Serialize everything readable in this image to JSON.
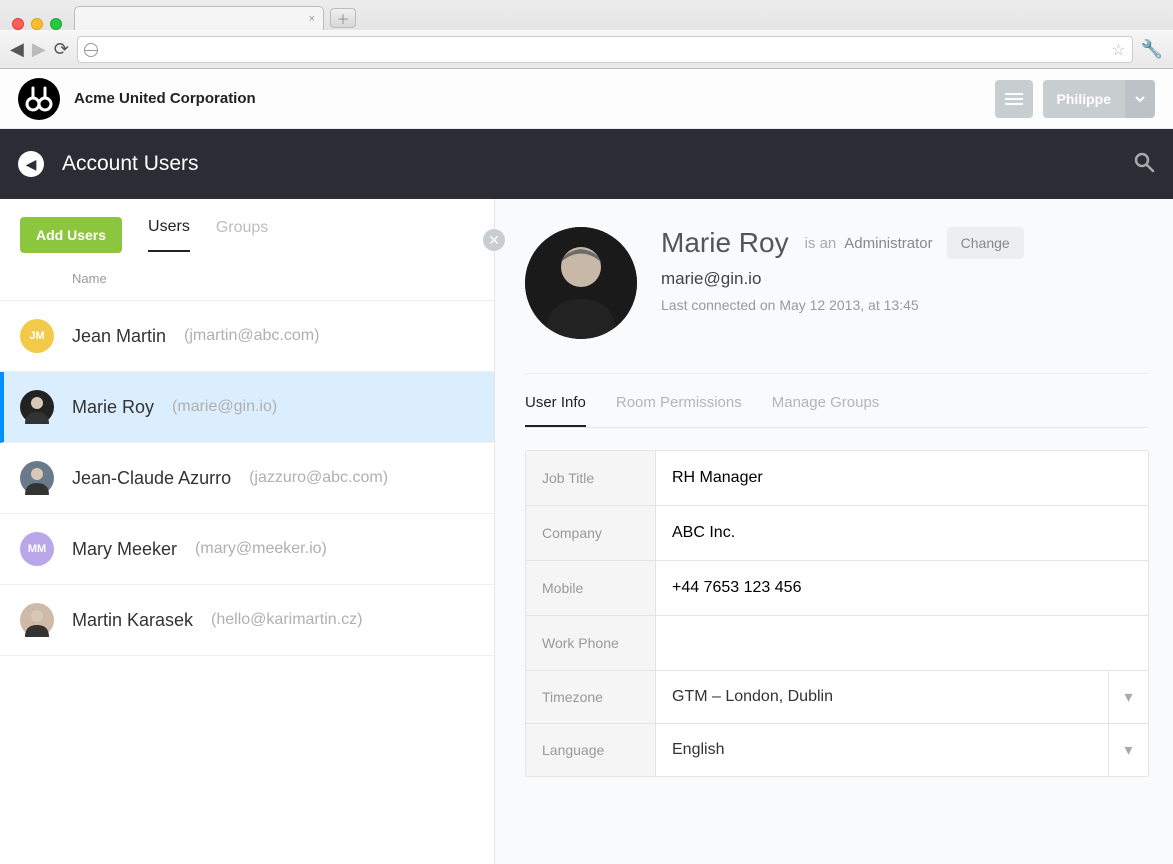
{
  "header": {
    "brand": "Acme United Corporation",
    "user": "Philippe"
  },
  "subheader": {
    "title": "Account Users"
  },
  "left": {
    "add_button": "Add Users",
    "tabs": {
      "users": "Users",
      "groups": "Groups"
    },
    "column_header": "Name",
    "users": [
      {
        "name": "Jean Martin",
        "email": "(jmartin@abc.com)",
        "initials": "JM",
        "color": "#f3c94a",
        "photo": false,
        "selected": false
      },
      {
        "name": "Marie Roy",
        "email": "(marie@gin.io)",
        "initials": "",
        "color": "#222",
        "photo": true,
        "selected": true
      },
      {
        "name": "Jean-Claude Azurro",
        "email": "(jazzuro@abc.com)",
        "initials": "",
        "color": "#6a7a8a",
        "photo": true,
        "selected": false
      },
      {
        "name": "Mary Meeker",
        "email": "(mary@meeker.io)",
        "initials": "MM",
        "color": "#b9a7e9",
        "photo": false,
        "selected": false
      },
      {
        "name": "Martin Karasek",
        "email": "(hello@karimartin.cz)",
        "initials": "",
        "color": "#d0b9a7",
        "photo": true,
        "selected": false
      }
    ]
  },
  "detail": {
    "name": "Marie Roy",
    "role_prefix": "is an",
    "role": "Administrator",
    "change_label": "Change",
    "email": "marie@gin.io",
    "last_connected_prefix": "Last connected on",
    "last_connected": "May 12 2013, at 13:45",
    "tabs": {
      "info": "User Info",
      "perms": "Room Permissions",
      "groups": "Manage Groups"
    },
    "fields": {
      "job_title": {
        "label": "Job Title",
        "value": "RH Manager"
      },
      "company": {
        "label": "Company",
        "value": "ABC Inc."
      },
      "mobile": {
        "label": "Mobile",
        "value": "+44 7653 123 456"
      },
      "work_phone": {
        "label": "Work Phone",
        "value": ""
      },
      "timezone": {
        "label": "Timezone",
        "value": "GTM – London, Dublin"
      },
      "language": {
        "label": "Language",
        "value": "English"
      }
    }
  }
}
